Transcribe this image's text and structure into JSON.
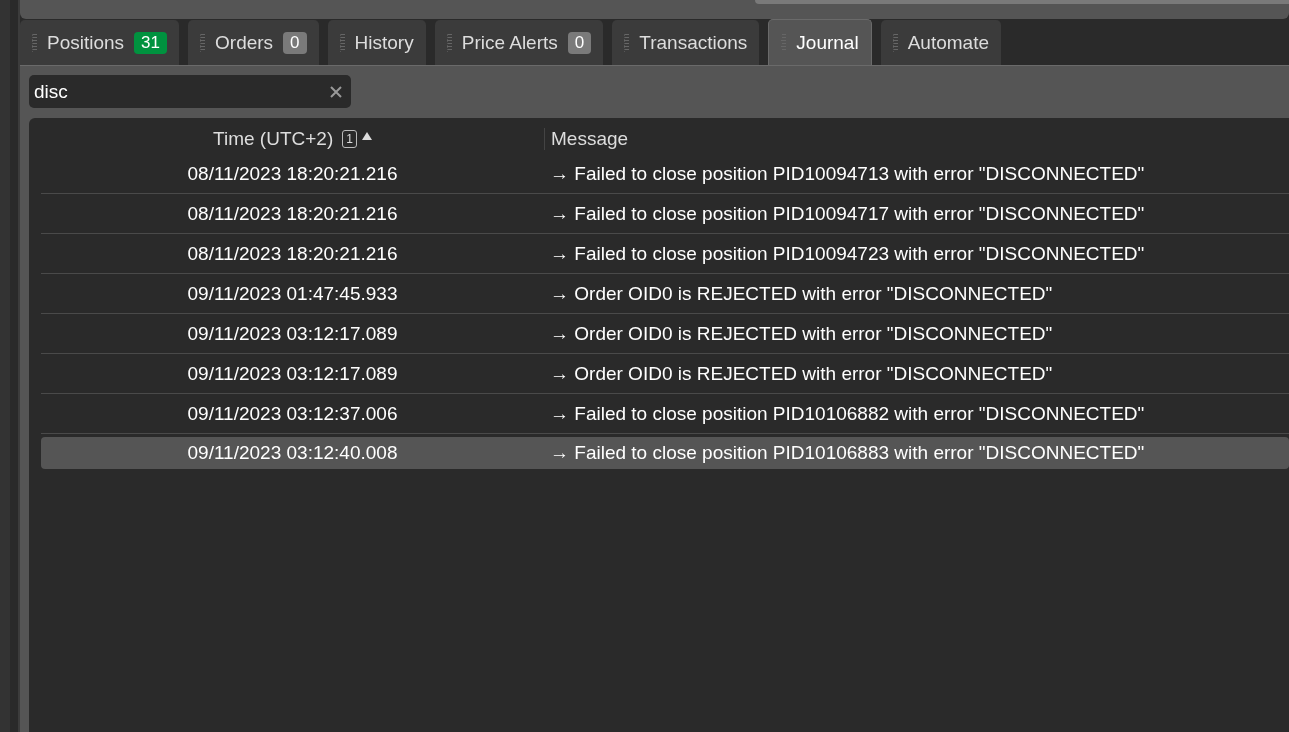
{
  "tabs": [
    {
      "label": "Positions",
      "badge": "31",
      "color": "#00923f",
      "selected": false
    },
    {
      "label": "Orders",
      "badge": "0",
      "color": "#7a7a7a",
      "selected": false
    },
    {
      "label": "History",
      "selected": false
    },
    {
      "label": "Price Alerts",
      "badge": "0",
      "color": "#7a7a7a",
      "selected": false
    },
    {
      "label": "Transactions",
      "selected": false
    },
    {
      "label": "Journal",
      "selected": true
    },
    {
      "label": "Automate",
      "selected": false
    }
  ],
  "search": {
    "value": "disc"
  },
  "table": {
    "columns": [
      {
        "label": "Time (UTC+2)",
        "sort_index": "1",
        "sorted_ascending": true
      },
      {
        "label": "Message"
      }
    ],
    "rows": [
      {
        "time": "08/11/2023 18:20:21.216",
        "message": "→ Failed to close position PID10094713 with error \"DISCONNECTED\"",
        "selected": false
      },
      {
        "time": "08/11/2023 18:20:21.216",
        "message": "→ Failed to close position PID10094717 with error \"DISCONNECTED\"",
        "selected": false
      },
      {
        "time": "08/11/2023 18:20:21.216",
        "message": "→ Failed to close position PID10094723 with error \"DISCONNECTED\"",
        "selected": false
      },
      {
        "time": "09/11/2023 01:47:45.933",
        "message": "→ Order OID0 is REJECTED with error \"DISCONNECTED\"",
        "selected": false
      },
      {
        "time": "09/11/2023 03:12:17.089",
        "message": "→ Order OID0 is REJECTED with error \"DISCONNECTED\"",
        "selected": false
      },
      {
        "time": "09/11/2023 03:12:17.089",
        "message": "→ Order OID0 is REJECTED with error \"DISCONNECTED\"",
        "selected": false
      },
      {
        "time": "09/11/2023 03:12:37.006",
        "message": "→ Failed to close position PID10106882 with error \"DISCONNECTED\"",
        "selected": false
      },
      {
        "time": "09/11/2023 03:12:40.008",
        "message": "→ Failed to close position PID10106883 with error \"DISCONNECTED\"",
        "selected": true
      }
    ]
  }
}
